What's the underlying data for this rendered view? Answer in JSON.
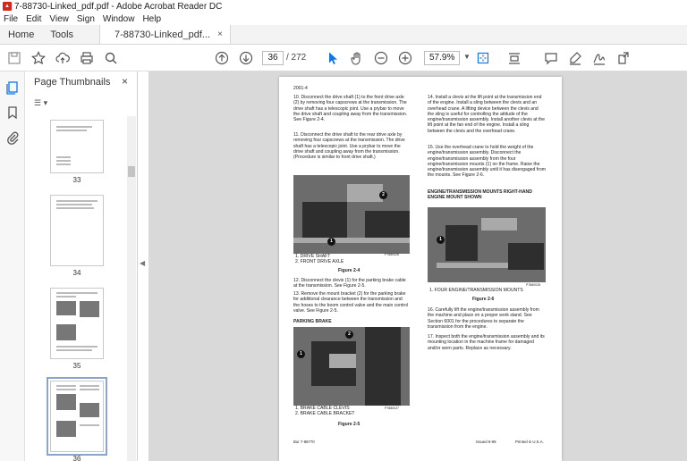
{
  "window": {
    "title": "7-88730-Linked_pdf.pdf - Adobe Acrobat Reader DC"
  },
  "menu": [
    "File",
    "Edit",
    "View",
    "Sign",
    "Window",
    "Help"
  ],
  "tabs": {
    "home": "Home",
    "tools": "Tools",
    "document": "7-88730-Linked_pdf...",
    "close": "×"
  },
  "toolbar": {
    "page_current": "36",
    "page_total": "/ 272",
    "zoom": "57.9%"
  },
  "sidebar": {
    "title": "Page Thumbnails",
    "close": "×",
    "thumbnails": [
      {
        "label": "33"
      },
      {
        "label": "34"
      },
      {
        "label": "35"
      },
      {
        "label": "36",
        "selected": true
      }
    ]
  },
  "document": {
    "header": "2001-4",
    "left_col": {
      "step10": "10. Disconnect the drive shaft (1) to the front drive axle (2) by removing four capscrews at the transmission. The drive shaft has a telescopic joint. Use a prybar to move the drive shaft and coupling away from the transmission. See Figure 2-4.",
      "step11": "11. Disconnect the drive shaft to the rear drive axle by removing four capscrews at the transmission. The drive shaft has a telescopic joint. Use a prybar to move the drive shaft and coupling away from the transmission. (Procedure is similar to front drive shaft.)",
      "fig4_legend_1": "1. DRIVE SHAFT",
      "fig4_legend_2": "2. FRONT DRIVE AXLE",
      "fig4_code": "P7880026",
      "fig4_caption": "Figure 2-4",
      "step12": "12. Disconnect the clevis (1) for the parking brake cable at the transmission. See Figure 2-5.",
      "step13": "13. Remove the mount bracket (2) for the parking brake for additional clearance between the transmission and the hoses to the boom control valve and the main control valve. See Figure 2-5.",
      "parking_heading": "PARKING BRAKE",
      "fig5_legend_1": "1. BRAKE CABLE CLEVIS",
      "fig5_legend_2": "2. BRAKE CABLE BRACKET",
      "fig5_code": "P7880027",
      "fig5_caption": "Figure 2-5",
      "footer_left": "Bur 7-88770"
    },
    "right_col": {
      "step14": "14. Install a clevis at the lift point at the transmission end of the engine. Install a sling between the clevis and an overhead crane. A lifting device between the clevis and the sling is useful for controlling the attitude of the engine/transmission assembly. Install another clevis at the lift point at the fan end of the engine. Install a sling between the clevis and the overhead crane.",
      "step15": "15. Use the overhead crane to hold the weight of the engine/transmission assembly. Disconnect the engine/transmission assembly from the four engine/transmission mounts (1) on the frame. Raise the engine/transmission assembly until it has disengaged from the mounts. See Figure 2-6.",
      "mounts_heading": "ENGINE/TRANSMISSION MOUNTS RIGHT-HAND ENGINE MOUNT SHOWN",
      "fig6_code": "P7880028",
      "fig6_legend_1": "1. FOUR ENGINE/TRANSMISSION MOUNTS",
      "fig6_caption": "Figure 2-6",
      "step16": "16. Carefully lift the engine/transmission assembly from the machine and place on a proper work stand. See Section 6001 for the procedures to separate the transmission from the engine.",
      "step17": "17. Inspect both the engine/transmission assembly and its mounting location in the machine frame for damaged and/or worn parts. Replace as necessary.",
      "footer_issued": "Issued 6-99",
      "footer_printed": "Printed in U.S.A."
    },
    "callouts": [
      "1",
      "2"
    ]
  },
  "colors": {
    "accent": "#1473e6",
    "pdf_red": "#d9251c",
    "viewer_bg": "#d9d9d9"
  }
}
